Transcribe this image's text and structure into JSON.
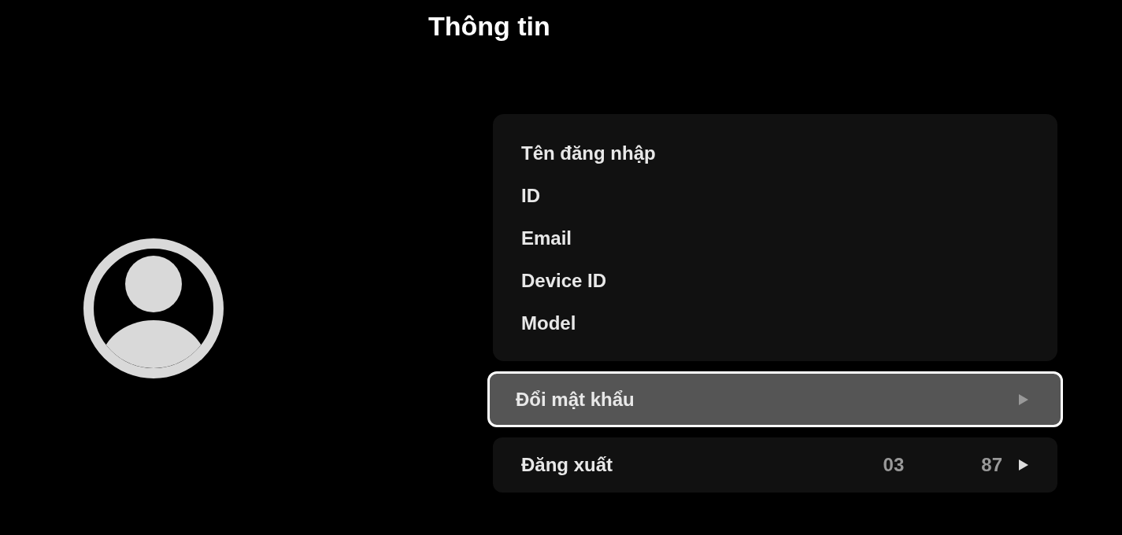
{
  "title": "Thông tin",
  "info_fields": [
    {
      "label": "Tên đăng nhập"
    },
    {
      "label": "ID"
    },
    {
      "label": "Email"
    },
    {
      "label": "Device ID"
    },
    {
      "label": "Model"
    }
  ],
  "actions": [
    {
      "label": "Đổi mật khẩu",
      "selected": true
    },
    {
      "label": "Đăng xuất",
      "selected": false,
      "value_1": "03",
      "value_2": "87"
    }
  ]
}
